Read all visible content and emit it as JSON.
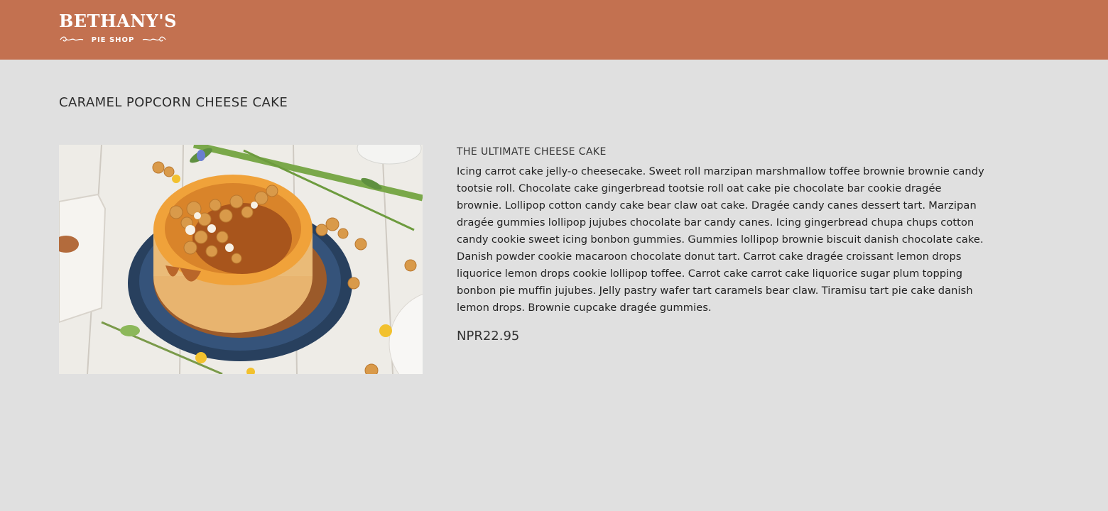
{
  "header": {
    "logo": {
      "name": "BETHANY'S",
      "tagline": "PIE SHOP",
      "background_color": "#c37150"
    }
  },
  "product": {
    "title": "CARAMEL POPCORN CHEESE CAKE",
    "subtitle": "THE ULTIMATE CHEESE CAKE",
    "description": "Icing carrot cake jelly-o cheesecake. Sweet roll marzipan marshmallow toffee brownie brownie candy tootsie roll. Chocolate cake gingerbread tootsie roll oat cake pie chocolate bar cookie dragée brownie. Lollipop cotton candy cake bear claw oat cake. Dragée candy canes dessert tart. Marzipan dragée gummies lollipop jujubes chocolate bar candy canes. Icing gingerbread chupa chups cotton candy cookie sweet icing bonbon gummies. Gummies lollipop brownie biscuit danish chocolate cake. Danish powder cookie macaroon chocolate donut tart. Carrot cake dragée croissant lemon drops liquorice lemon drops cookie lollipop toffee. Carrot cake carrot cake liquorice sugar plum topping bonbon pie muffin jujubes. Jelly pastry wafer tart caramels bear claw. Tiramisu tart pie cake danish lemon drops. Brownie cupcake dragée gummies.",
    "price": "NPR22.95",
    "image": {
      "alt_icon": "cheesecake-photo"
    }
  },
  "page": {
    "background_color": "#e0e0e0"
  }
}
